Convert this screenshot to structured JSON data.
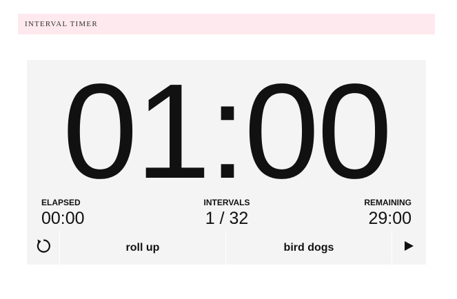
{
  "header": {
    "title": "INTERVAL TIMER",
    "background": "#fde9ee"
  },
  "timer": {
    "clock": "01:00",
    "elapsed_label": "ELAPSED",
    "elapsed_value": "00:00",
    "intervals_label": "INTERVALS",
    "intervals_value": "1 / 32",
    "remaining_label": "REMAINING",
    "remaining_value": "29:00"
  },
  "controls": {
    "reset_icon": "reset-icon",
    "current_interval": "roll up",
    "next_interval": "bird dogs",
    "play_icon": "play-icon"
  },
  "colors": {
    "panel": "#f4f4f4",
    "text": "#111111"
  }
}
